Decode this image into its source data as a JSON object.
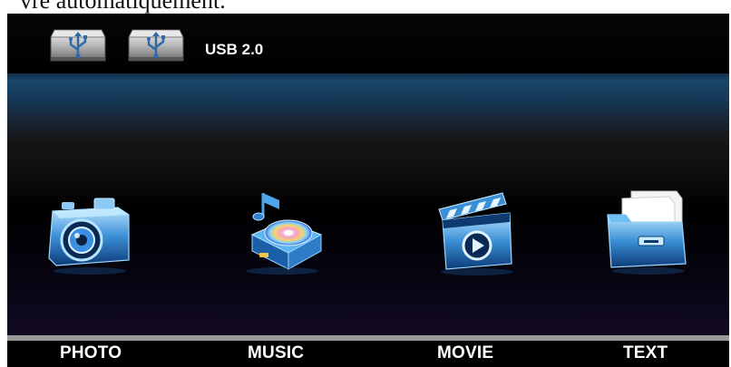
{
  "page": {
    "top_text": "vre automatiquement."
  },
  "header": {
    "device_icons": [
      "usb-drive-icon",
      "usb-drive-icon"
    ],
    "device_label": "USB 2.0"
  },
  "menu": {
    "items": [
      {
        "label": "PHOTO",
        "icon": "camera-icon"
      },
      {
        "label": "MUSIC",
        "icon": "music-disc-icon"
      },
      {
        "label": "MOVIE",
        "icon": "clapperboard-icon"
      },
      {
        "label": "TEXT",
        "icon": "document-folder-icon"
      }
    ]
  },
  "colors": {
    "screen_bg": "#000000",
    "accent_blue": "#1a4668",
    "label_text": "#ffffff",
    "divider": "#9a9a9a"
  }
}
